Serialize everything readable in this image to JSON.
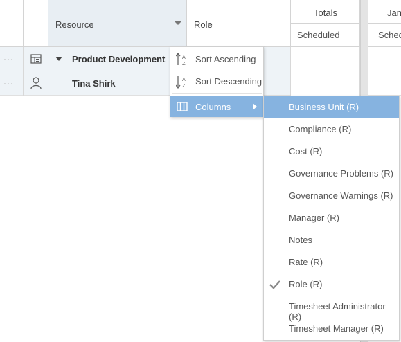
{
  "header": {
    "resource_label": "Resource",
    "role_label": "Role",
    "totals_label": "Totals",
    "scheduled_label": "Scheduled",
    "month_label": "Jan",
    "month_sub_label": "Sched"
  },
  "rows": [
    {
      "name": "Product Development",
      "icon": "org-chart-icon",
      "expanded": true
    },
    {
      "name": "Tina Shirk",
      "icon": "person-icon"
    }
  ],
  "context_menu": {
    "items": [
      {
        "label": "Sort Ascending",
        "icon": "sort-ascending-icon"
      },
      {
        "label": "Sort Descending",
        "icon": "sort-descending-icon"
      },
      {
        "label": "Columns",
        "icon": "columns-icon",
        "has_submenu": true,
        "active": true
      }
    ]
  },
  "columns_submenu": {
    "items": [
      {
        "label": "Business Unit (R)",
        "checked": false,
        "highlighted": true
      },
      {
        "label": "Compliance (R)",
        "checked": false
      },
      {
        "label": "Cost (R)",
        "checked": false
      },
      {
        "label": "Governance Problems (R)",
        "checked": false
      },
      {
        "label": "Governance Warnings (R)",
        "checked": false
      },
      {
        "label": "Manager (R)",
        "checked": false
      },
      {
        "label": "Notes",
        "checked": false
      },
      {
        "label": "Rate (R)",
        "checked": false
      },
      {
        "label": "Role (R)",
        "checked": true
      },
      {
        "label": "Timesheet Administrator (R)",
        "checked": false
      },
      {
        "label": "Timesheet Manager (R)",
        "checked": false
      }
    ]
  },
  "colors": {
    "menu_highlight": "#86b3e0",
    "header_resource_bg": "#e8eef3",
    "row_bg": "#eef3f7"
  }
}
